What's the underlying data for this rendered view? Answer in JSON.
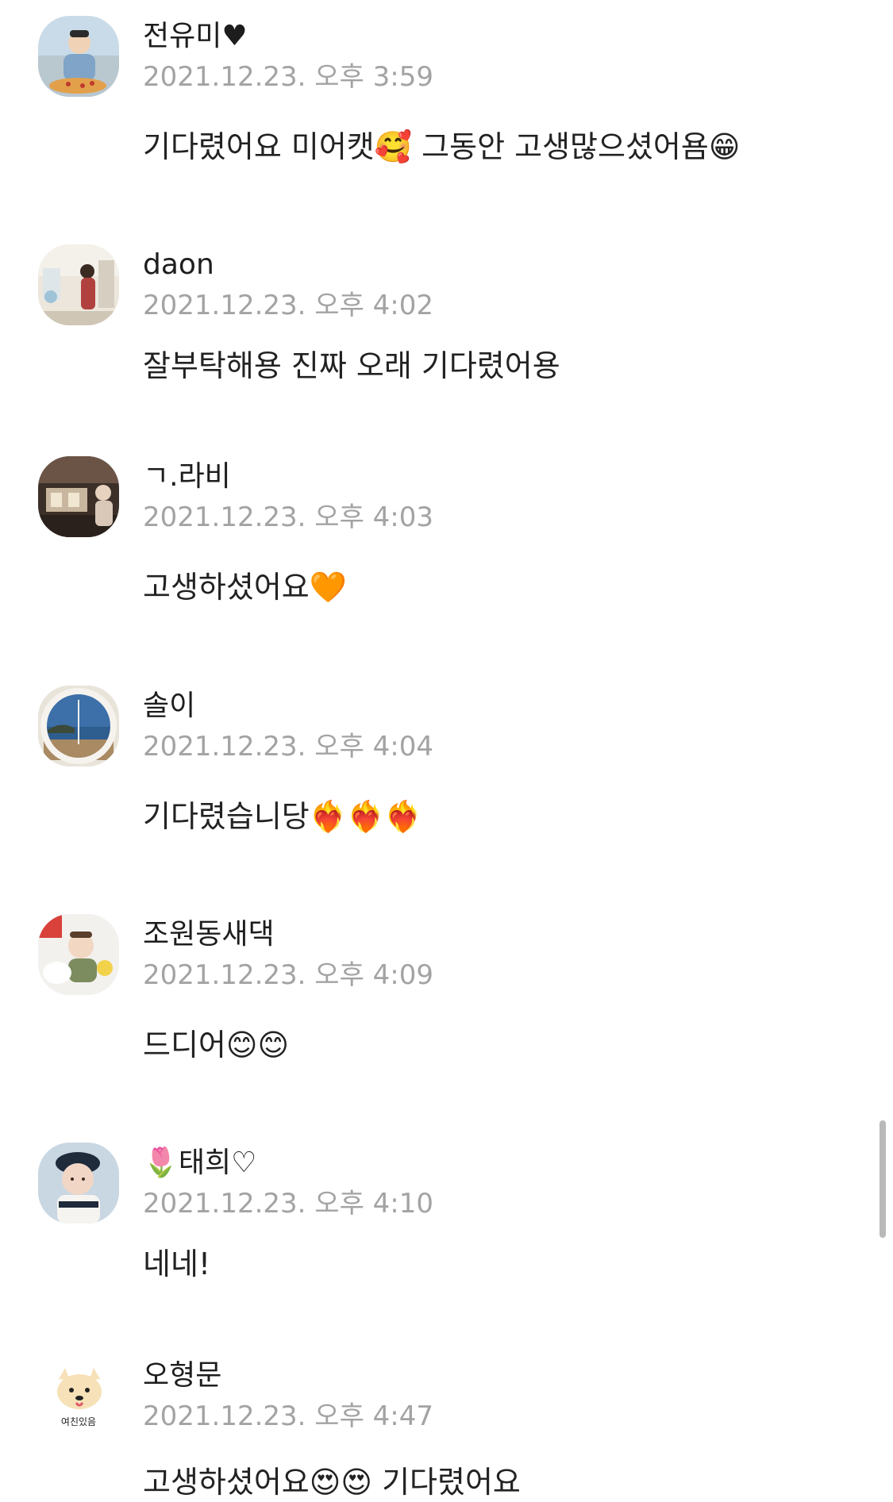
{
  "comments": [
    {
      "author": "전유미♥",
      "timestamp": "2021.12.23. 오후 3:59",
      "text": "기다렸어요 미어캣🥰 그동안 고생많으셨어욤😁"
    },
    {
      "author": "daon",
      "timestamp": "2021.12.23. 오후 4:02",
      "text": "잘부탁해용 진짜 오래 기다렸어용"
    },
    {
      "author": "ㄱ.라비",
      "timestamp": "2021.12.23. 오후 4:03",
      "text": "고생하셨어요🧡"
    },
    {
      "author": "솔이",
      "timestamp": "2021.12.23. 오후 4:04",
      "text": "기다렸습니당❤️‍🔥❤️‍🔥❤️‍🔥"
    },
    {
      "author": "조원동새댁",
      "timestamp": "2021.12.23. 오후 4:09",
      "text": "드디어😊😊"
    },
    {
      "author": "🌷태희♡",
      "timestamp": "2021.12.23. 오후 4:10",
      "text": "네네!"
    },
    {
      "author": "오형문",
      "timestamp": "2021.12.23. 오후 4:47",
      "text": "고생하셨어요😍😍 기다렸어요",
      "avatar_caption": "여친있음"
    }
  ]
}
